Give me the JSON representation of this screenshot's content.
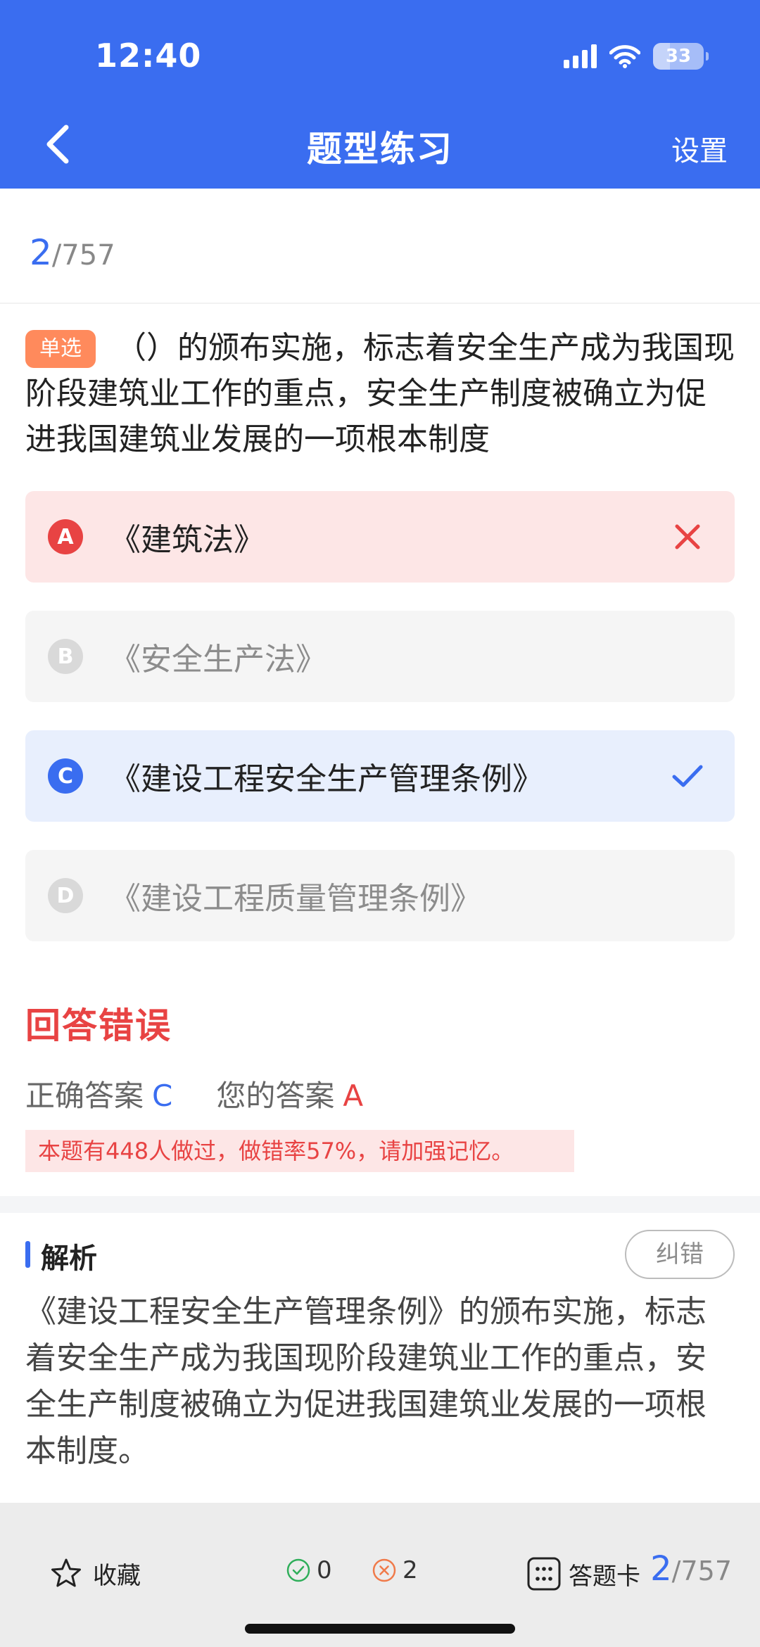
{
  "status_bar": {
    "time": "12:40",
    "battery": "33",
    "battery_level": 0.33
  },
  "nav": {
    "title": "题型练习",
    "settings_label": "设置"
  },
  "progress": {
    "current": "2",
    "total": "/757"
  },
  "question": {
    "type_tag": "单选",
    "text": "（）的颁布实施，标志着安全生产成为我国现阶段建筑业工作的重点，安全生产制度被确立为促进我国建筑业发展的一项根本制度"
  },
  "options": [
    {
      "letter": "A",
      "text": "《建筑法》",
      "state": "wrong"
    },
    {
      "letter": "B",
      "text": "《安全生产法》",
      "state": "neutral"
    },
    {
      "letter": "C",
      "text": "《建设工程安全生产管理条例》",
      "state": "correct"
    },
    {
      "letter": "D",
      "text": "《建设工程质量管理条例》",
      "state": "neutral"
    }
  ],
  "result": {
    "title": "回答错误",
    "correct_label": "正确答案",
    "correct_value": "C",
    "yours_label": "您的答案",
    "yours_value": "A",
    "hint": "本题有448人做过，做错率57%，请加强记忆。"
  },
  "analysis": {
    "title": "解析",
    "report_label": "纠错",
    "text": "《建设工程安全生产管理条例》的颁布实施，标志着安全生产成为我国现阶段建筑业工作的重点，安全生产制度被确立为促进我国建筑业发展的一项根本制度。"
  },
  "footer": {
    "collect_label": "收藏",
    "right_count": "0",
    "wrong_count": "2",
    "card_label": "答题卡",
    "current": "2",
    "total": "/757"
  },
  "colors": {
    "accent": "#3a6df0",
    "error": "#e84343",
    "tag": "#ff8a5c"
  }
}
